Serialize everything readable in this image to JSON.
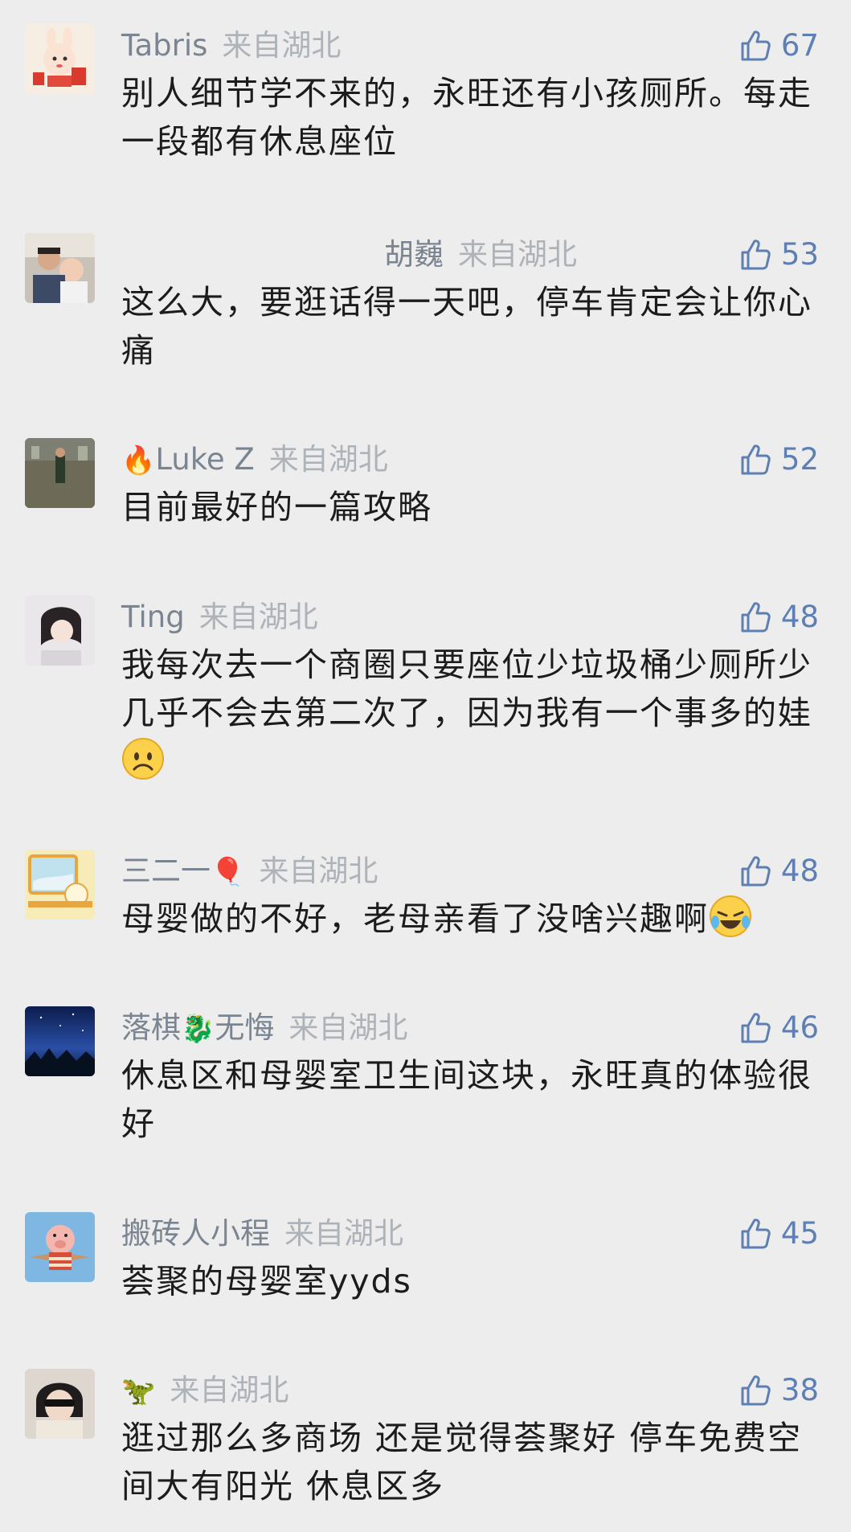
{
  "comments": [
    {
      "username": "Tabris",
      "location": "来自湖北",
      "likes": "67",
      "text": "别人细节学不来的，永旺还有小孩厕所。每走一段都有休息座位",
      "avatar_icon": "bunny-newyear-avatar"
    },
    {
      "username": "胡巍",
      "location": "来自湖北",
      "likes": "53",
      "text": "这么大，要逛话得一天吧，停车肯定会让你心痛",
      "avatar_icon": "father-baby-photo-avatar"
    },
    {
      "name_emoji": "🔥",
      "username": "Luke Z",
      "location": "来自湖北",
      "likes": "52",
      "text": "目前最好的一篇攻略",
      "avatar_icon": "mall-photo-avatar"
    },
    {
      "username": "Ting",
      "location": "来自湖北",
      "likes": "48",
      "text": "我每次去一个商圈只要座位少垃圾桶少厕所少几乎不会去第二次了，因为我有一个事多的娃",
      "text_emoji": "sad-face-emoji",
      "avatar_icon": "girl-photo-avatar"
    },
    {
      "username": "三二一",
      "name_emoji": "🎈",
      "location": "来自湖北",
      "likes": "48",
      "text": "母婴做的不好，老母亲看了没啥兴趣啊",
      "text_emoji": "laugh-cry-emoji",
      "avatar_icon": "cartoon-window-avatar"
    },
    {
      "username": "落棋",
      "name_emoji": "🐉",
      "username_suffix": "无悔",
      "location": "来自湖北",
      "likes": "46",
      "text": "休息区和母婴室卫生间这块，永旺真的体验很好",
      "avatar_icon": "night-sky-avatar"
    },
    {
      "username": "搬砖人小程",
      "location": "来自湖北",
      "likes": "45",
      "text": "荟聚的母婴室yyds",
      "avatar_icon": "pig-toy-avatar"
    },
    {
      "name_emoji": "🦖",
      "location": "来自湖北",
      "likes": "38",
      "text": "逛过那么多商场 还是觉得荟聚好 停车免费空间大有阳光 休息区多",
      "avatar_icon": "sunglasses-man-avatar"
    }
  ],
  "colors": {
    "background": "#ededed",
    "username": "#7b8591",
    "location": "#aeb3b9",
    "likes": "#5d7fb4",
    "text": "#1c1c1c"
  },
  "icons": {
    "like": "thumbs-up-icon"
  }
}
